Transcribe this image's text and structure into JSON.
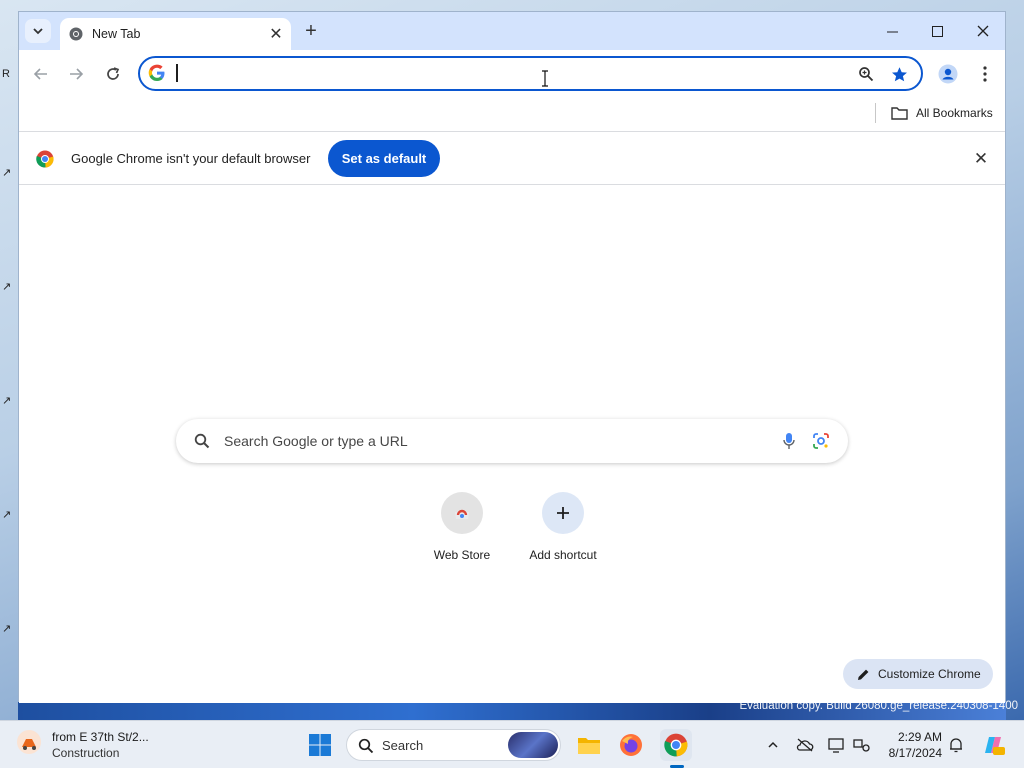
{
  "browser": {
    "tab": {
      "title": "New Tab"
    },
    "omnibox": {
      "value": ""
    },
    "bookmarks_bar": {
      "all_bookmarks_label": "All Bookmarks"
    },
    "infobar": {
      "message": "Google Chrome isn't your default browser",
      "set_default_label": "Set as default"
    },
    "ntp": {
      "search_placeholder": "Search Google or type a URL",
      "shortcuts": [
        {
          "label": "Web Store",
          "icon": "web-store-icon"
        },
        {
          "label": "Add shortcut",
          "icon": "plus-icon"
        }
      ],
      "customize_label": "Customize Chrome"
    }
  },
  "desktop": {
    "watermark": "Evaluation copy. Build 26080.ge_release.240308-1400"
  },
  "taskbar": {
    "weather": {
      "title": "from E 37th St/2...",
      "subtitle": "Construction"
    },
    "search_label": "Search",
    "clock": {
      "time": "2:29 AM",
      "date": "8/17/2024"
    }
  },
  "colors": {
    "accent": "#0b57d0",
    "tabstrip": "#d3e3fd"
  }
}
